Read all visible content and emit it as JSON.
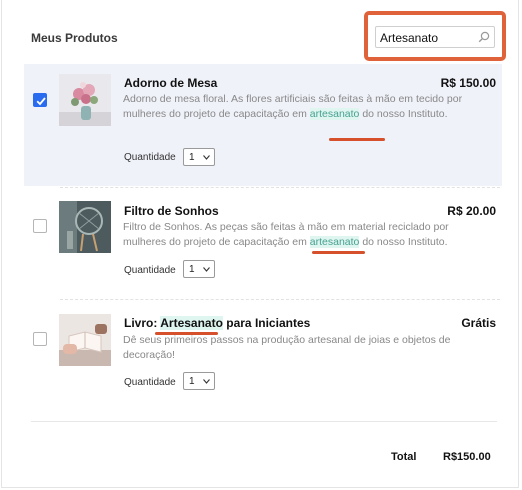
{
  "header": {
    "title": "Meus Produtos",
    "search": {
      "value": "Artesanato",
      "icon": "search-icon"
    }
  },
  "accent_colors": {
    "highlight_box": "#e0623a",
    "checked": "#2a6cf0",
    "match_bg": "#dff5f0",
    "match_text": "#47a191"
  },
  "products": [
    {
      "name": "Adorno de Mesa",
      "price": "R$ 150.00",
      "desc_before": "Adorno de mesa floral. As flores artificiais são feitas à mão em tecido por mulheres do projeto de capacitação em ",
      "desc_match": "artesanato",
      "desc_after": " do nosso Instituto.",
      "qty_label": "Quantidade",
      "qty_value": "1",
      "checked": true
    },
    {
      "name": "Filtro de Sonhos",
      "price": "R$ 20.00",
      "desc_before": "Filtro de Sonhos. As peças são feitas à mão em material reciclado por mulheres do projeto de capacitação em ",
      "desc_match": "artesanato",
      "desc_after": " do nosso Instituto.",
      "qty_label": "Quantidade",
      "qty_value": "1",
      "checked": false
    },
    {
      "name_before": "Livro: ",
      "name_match": "Artesanato",
      "name_after": " para Iniciantes",
      "price": "Grátis",
      "desc": "Dê seus primeiros passos na produção artesanal de joias e objetos de decoração!",
      "qty_label": "Quantidade",
      "qty_value": "1",
      "checked": false
    }
  ],
  "total": {
    "label": "Total",
    "value": "R$150.00"
  }
}
